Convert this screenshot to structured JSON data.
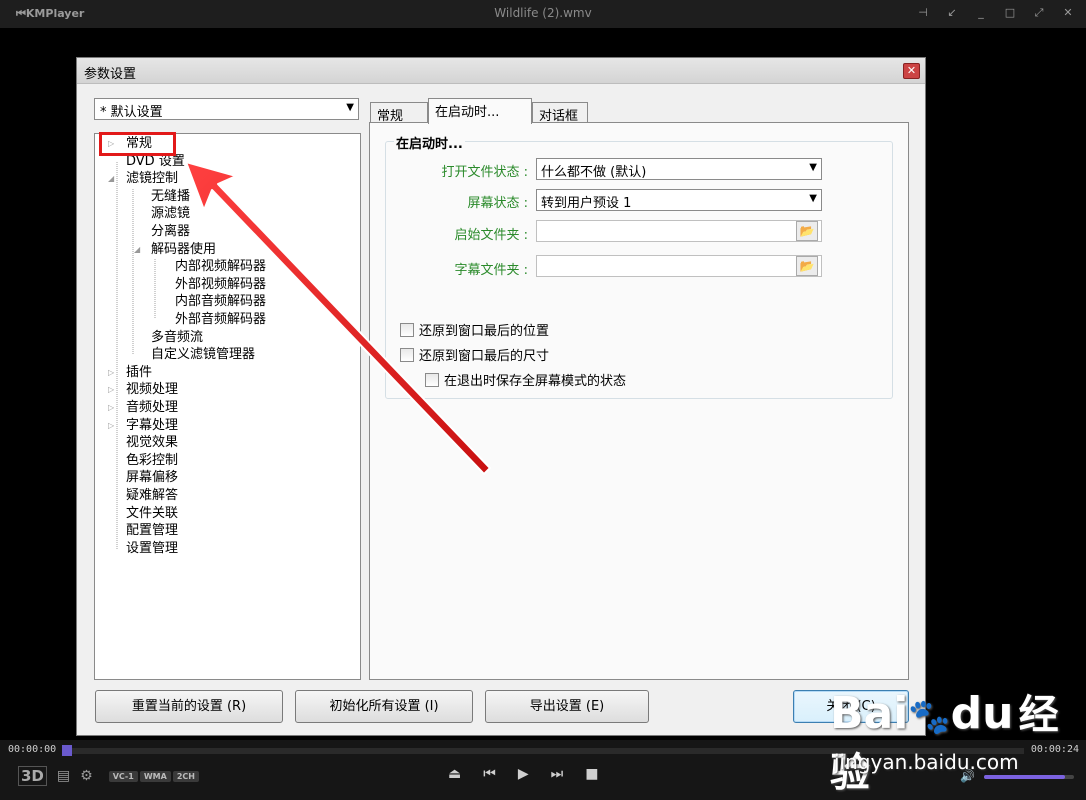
{
  "player": {
    "app_name": "KMPlayer",
    "file_title": "Wildlife (2).wmv",
    "window_controls": [
      "pin-icon",
      "compact-icon",
      "minimize-icon",
      "maximize-icon",
      "fullscreen-icon",
      "close-icon"
    ],
    "time_elapsed": "00:00:00",
    "time_total": "00:00:24",
    "seek_progress": 0.0,
    "volume_level": 0.9,
    "label_3d": "3D",
    "codec_badges": [
      "VC-1",
      "WMA",
      "2CH"
    ],
    "transport_icons": [
      "eject-icon",
      "previous-icon",
      "play-icon",
      "next-icon",
      "stop-icon"
    ],
    "accent_color": "#7b62e0"
  },
  "dialog": {
    "title": "参数设置",
    "profile": "* 默认设置",
    "tree": [
      {
        "label": "常规",
        "expander": "▷"
      },
      {
        "label": "DVD 设置",
        "expander": ""
      },
      {
        "label": "滤镜控制",
        "expander": "◢"
      },
      {
        "label": "无缝播",
        "expander": ""
      },
      {
        "label": "源滤镜",
        "expander": ""
      },
      {
        "label": "分离器",
        "expander": ""
      },
      {
        "label": "解码器使用",
        "expander": "◢"
      },
      {
        "label": "内部视频解码器",
        "expander": ""
      },
      {
        "label": "外部视频解码器",
        "expander": ""
      },
      {
        "label": "内部音频解码器",
        "expander": ""
      },
      {
        "label": "外部音频解码器",
        "expander": ""
      },
      {
        "label": "多音频流",
        "expander": ""
      },
      {
        "label": "自定义滤镜管理器",
        "expander": ""
      },
      {
        "label": "插件",
        "expander": "▷"
      },
      {
        "label": "视频处理",
        "expander": "▷"
      },
      {
        "label": "音频处理",
        "expander": "▷"
      },
      {
        "label": "字幕处理",
        "expander": "▷"
      },
      {
        "label": "视觉效果",
        "expander": ""
      },
      {
        "label": "色彩控制",
        "expander": ""
      },
      {
        "label": "屏幕偏移",
        "expander": ""
      },
      {
        "label": "疑难解答",
        "expander": ""
      },
      {
        "label": "文件关联",
        "expander": ""
      },
      {
        "label": "配置管理",
        "expander": ""
      },
      {
        "label": "设置管理",
        "expander": ""
      }
    ],
    "tabs": [
      {
        "label": "常规"
      },
      {
        "label": "在启动时..."
      },
      {
        "label": "对话框"
      }
    ],
    "group_title": "在启动时...",
    "fields": {
      "open_file_state_label": "打开文件状态 :",
      "open_file_state_value": "什么都不做 (默认)",
      "screen_state_label": "屏幕状态 :",
      "screen_state_value": "转到用户预设 1",
      "start_folder_label": "启始文件夹 :",
      "start_folder_value": "",
      "subtitle_folder_label": "字幕文件夹 :",
      "subtitle_folder_value": ""
    },
    "checkboxes": {
      "restore_position": "还原到窗口最后的位置",
      "restore_size": "还原到窗口最后的尺寸",
      "save_fullscreen": "在退出时保存全屏幕模式的状态"
    },
    "buttons": {
      "reset_current": "重置当前的设置 (R)",
      "init_all": "初始化所有设置 (I)",
      "export": "导出设置 (E)",
      "close": "关闭 (C)"
    }
  },
  "watermark": {
    "brand": "Bai",
    "brand_suffix": "经验",
    "url": "jingyan.baidu.com"
  },
  "annotation_color": "#e21919"
}
